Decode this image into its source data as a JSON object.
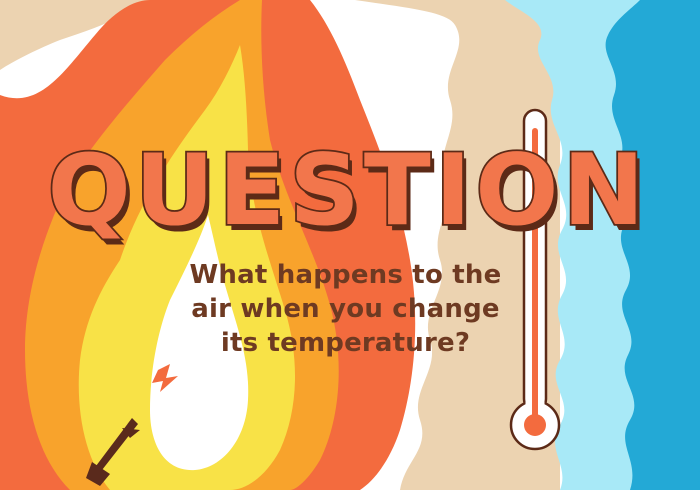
{
  "title": "QUESTION",
  "question_lines": [
    "What happens to the",
    "air when you change",
    "its temperature?"
  ],
  "colors": {
    "sky_white": "#ffffff",
    "sand": "#ecd3b1",
    "light_blue": "#a8e9f7",
    "blue": "#23a9d6",
    "flame_outer": "#f36b3e",
    "flame_middle": "#f8a32c",
    "flame_inner": "#f8e247",
    "flame_core": "#ffffff",
    "title_fill": "#f2764c",
    "title_outline": "#5c2a17",
    "text": "#6e3a22",
    "match_head": "#5a2a1c"
  },
  "icons": {
    "thermometer": "thermometer-icon",
    "match": "burnt-match-icon"
  }
}
